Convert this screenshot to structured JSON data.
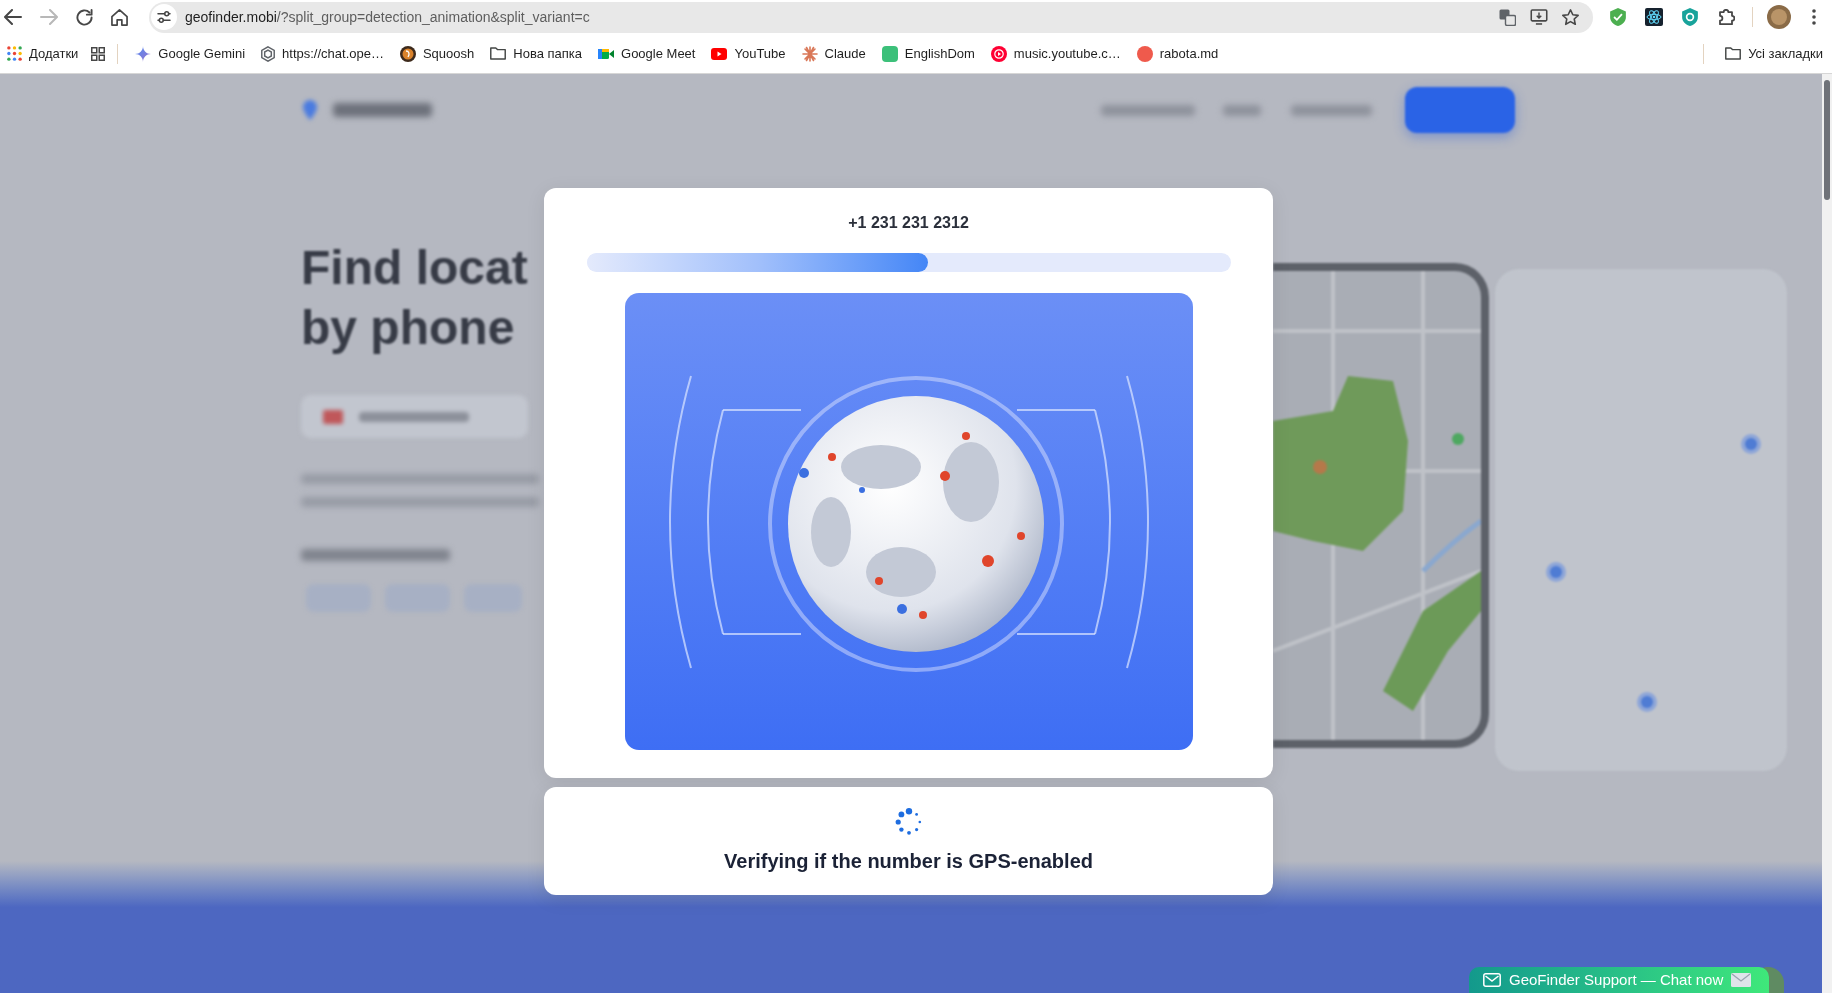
{
  "browser": {
    "nav_buttons": [
      {
        "kind": "back",
        "disabled": false
      },
      {
        "kind": "forward",
        "disabled": true
      },
      {
        "kind": "reload",
        "disabled": false
      },
      {
        "kind": "home",
        "disabled": false
      }
    ],
    "address_bar": {
      "host": "geofinder.mobi",
      "path": "/?split_group=detection_animation&split_variant=c"
    },
    "bookmarks_bar": {
      "apps": {
        "label": "Додатки"
      },
      "items": [
        {
          "kind": "sparkle",
          "label": "Google Gemini"
        },
        {
          "kind": "hexagon",
          "label": "https://chat.ope…"
        },
        {
          "kind": "logo",
          "label": "Squoosh"
        },
        {
          "kind": "folder",
          "label": "Нова папка"
        },
        {
          "kind": "camera",
          "label": "Google Meet"
        },
        {
          "kind": "video",
          "label": "YouTube"
        },
        {
          "kind": "burst",
          "label": "Claude"
        },
        {
          "kind": "tile",
          "label": "EnglishDom"
        },
        {
          "kind": "music",
          "label": "music.youtube.c…"
        },
        {
          "kind": "badge",
          "label": "rabota.md"
        }
      ],
      "all_bookmarks": {
        "label": "Усі закладки"
      }
    }
  },
  "page": {
    "headline": [
      "Find locat",
      "by phone"
    ]
  },
  "dialog": {
    "phone_number": "+1 231 231 2312",
    "progress": {
      "level": 0.53
    },
    "status": "Verifying if the number is GPS-enabled"
  },
  "chat_widget": {
    "label": "GeoFinder Support — Chat now"
  }
}
